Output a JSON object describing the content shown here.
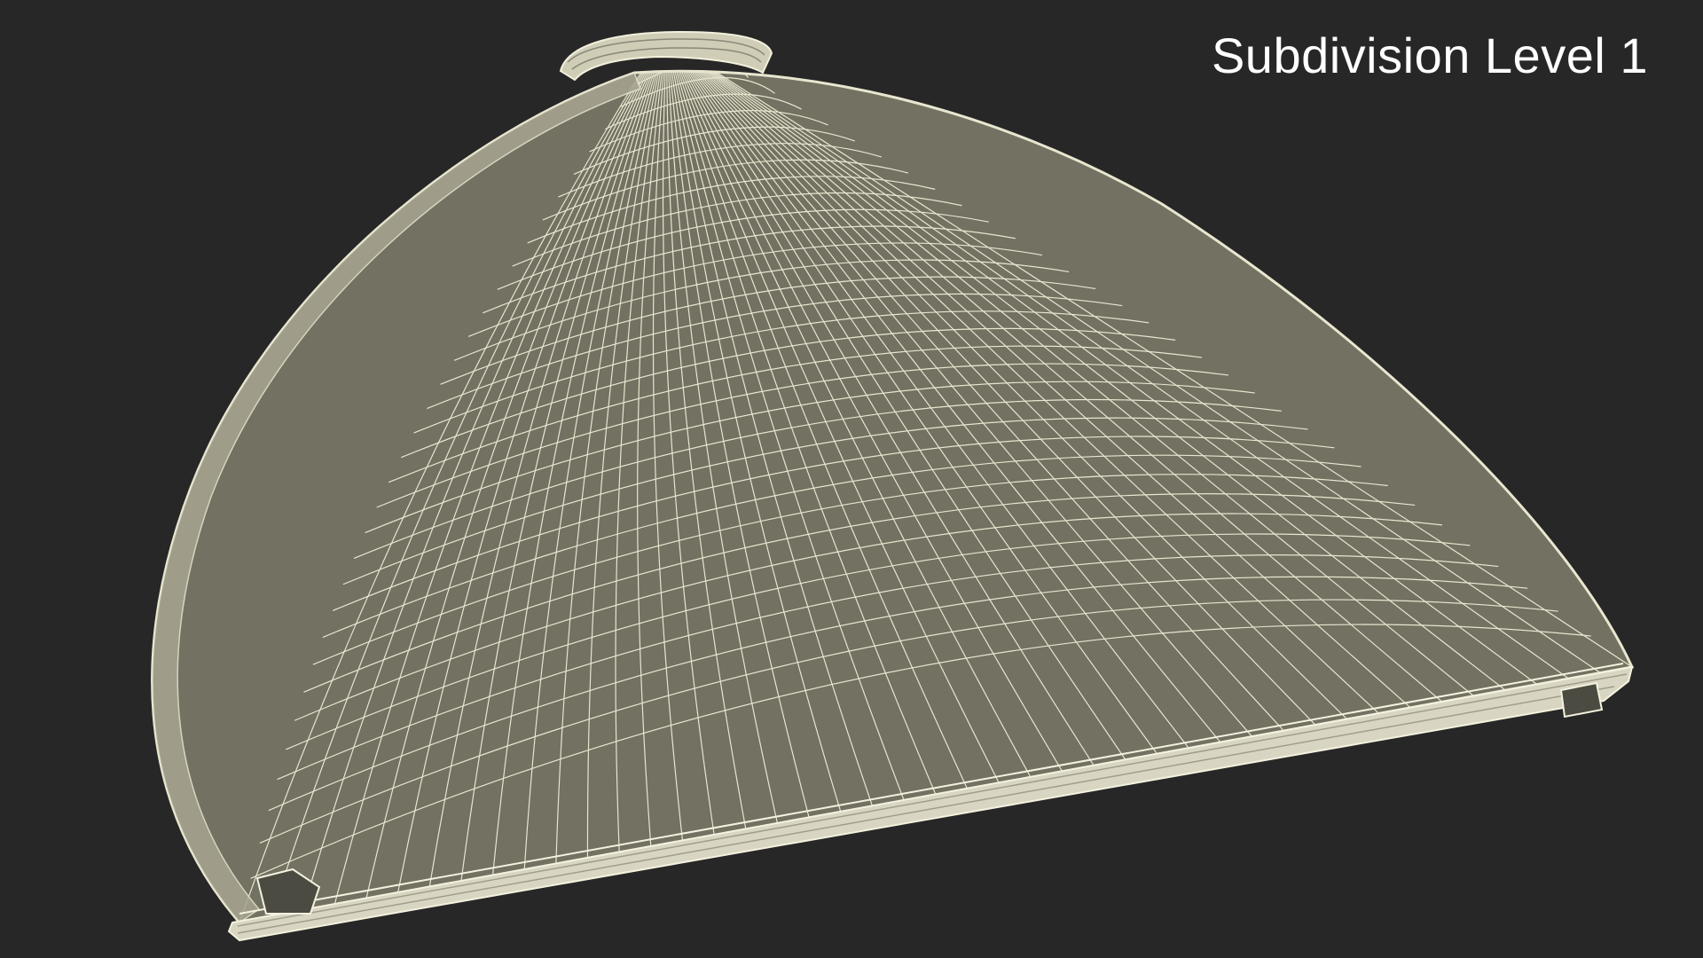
{
  "viewport": {
    "label": "Subdivision Level 1",
    "background_color": "#272727"
  },
  "model": {
    "subject": "half-dome case with carry handle",
    "display_mode": "wireframe",
    "surface_color": "#727162",
    "wire_color": "#e8e6cf",
    "rim_color": "#d8d6c2"
  }
}
